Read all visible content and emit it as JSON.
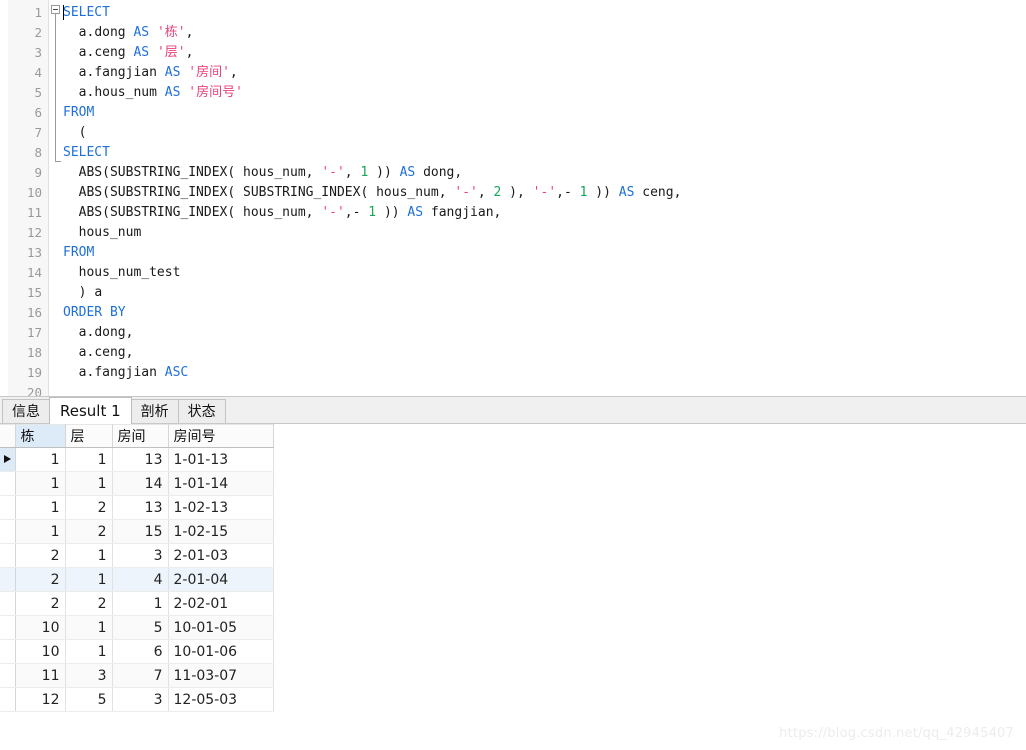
{
  "editor": {
    "caret_line": 1,
    "fold_marker_line": 7,
    "fold_range": [
      7,
      15
    ],
    "line_numbers": [
      "1",
      "2",
      "3",
      "4",
      "5",
      "6",
      "7",
      "8",
      "9",
      "10",
      "11",
      "12",
      "13",
      "14",
      "15",
      "16",
      "17",
      "18",
      "19",
      "20"
    ],
    "lines": [
      {
        "n": "1",
        "text": "SELECT"
      },
      {
        "n": "2",
        "text": "  a.dong AS '栋',"
      },
      {
        "n": "3",
        "text": "  a.ceng AS '层',"
      },
      {
        "n": "4",
        "text": "  a.fangjian AS '房间',"
      },
      {
        "n": "5",
        "text": "  a.hous_num AS '房间号'"
      },
      {
        "n": "6",
        "text": "FROM"
      },
      {
        "n": "7",
        "text": "  ("
      },
      {
        "n": "8",
        "text": "SELECT"
      },
      {
        "n": "9",
        "text": "  ABS(SUBSTRING_INDEX( hous_num, '-', 1 )) AS dong,"
      },
      {
        "n": "10",
        "text": "  ABS(SUBSTRING_INDEX( SUBSTRING_INDEX( hous_num, '-', 2 ), '-',- 1 )) AS ceng,"
      },
      {
        "n": "11",
        "text": "  ABS(SUBSTRING_INDEX( hous_num, '-',- 1 )) AS fangjian,"
      },
      {
        "n": "12",
        "text": "  hous_num"
      },
      {
        "n": "13",
        "text": "FROM"
      },
      {
        "n": "14",
        "text": "  hous_num_test"
      },
      {
        "n": "15",
        "text": "  ) a"
      },
      {
        "n": "16",
        "text": "ORDER BY"
      },
      {
        "n": "17",
        "text": "  a.dong,"
      },
      {
        "n": "18",
        "text": "  a.ceng,"
      },
      {
        "n": "19",
        "text": "  a.fangjian ASC"
      },
      {
        "n": "20",
        "text": ""
      }
    ],
    "colors": {
      "keyword": "#1e6fd9",
      "string": "#e8447a",
      "number": "#18a558",
      "text": "#1a1a1a",
      "gutter_bg": "#f7f7f7",
      "gutter_fg": "#9a9a9a"
    }
  },
  "tabs": [
    {
      "label": "信息",
      "active": false
    },
    {
      "label": "Result 1",
      "active": true
    },
    {
      "label": "剖析",
      "active": false
    },
    {
      "label": "状态",
      "active": false
    }
  ],
  "result_grid": {
    "columns": [
      "栋",
      "层",
      "房间",
      "房间号"
    ],
    "selected_column_index": 0,
    "current_row_index": 0,
    "highlighted_row_index": 5,
    "rows": [
      [
        "1",
        "1",
        "13",
        "1-01-13"
      ],
      [
        "1",
        "1",
        "14",
        "1-01-14"
      ],
      [
        "1",
        "2",
        "13",
        "1-02-13"
      ],
      [
        "1",
        "2",
        "15",
        "1-02-15"
      ],
      [
        "2",
        "1",
        "3",
        "2-01-03"
      ],
      [
        "2",
        "1",
        "4",
        "2-01-04"
      ],
      [
        "2",
        "2",
        "1",
        "2-02-01"
      ],
      [
        "10",
        "1",
        "5",
        "10-01-05"
      ],
      [
        "10",
        "1",
        "6",
        "10-01-06"
      ],
      [
        "11",
        "3",
        "7",
        "11-03-07"
      ],
      [
        "12",
        "5",
        "3",
        "12-05-03"
      ]
    ]
  },
  "watermark": {
    "text": "https://blog.csdn.net/qq_42945407"
  }
}
